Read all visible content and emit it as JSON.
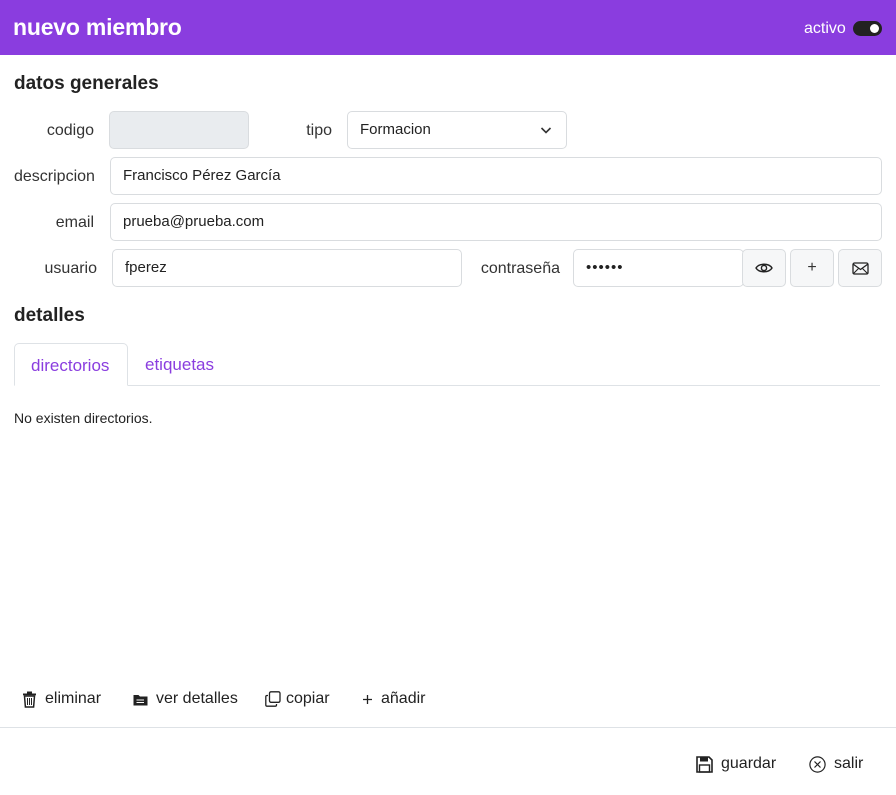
{
  "header": {
    "title": "nuevo miembro",
    "active_label": "activo",
    "active_on": true,
    "color": "#8a3ddf"
  },
  "general": {
    "title": "datos generales",
    "codigo": {
      "label": "codigo",
      "value": ""
    },
    "tipo": {
      "label": "tipo",
      "value": "Formacion"
    },
    "descripcion": {
      "label": "descripcion",
      "value": "Francisco Pérez García"
    },
    "email": {
      "label": "email",
      "value": "prueba@prueba.com"
    },
    "usuario": {
      "label": "usuario",
      "value": "fperez"
    },
    "contrasena": {
      "label": "contraseña",
      "value": "••••••"
    },
    "buttons": {
      "show_icon": "eye-icon",
      "generate_label": "+",
      "send_icon": "envelope-icon"
    }
  },
  "details": {
    "title": "detalles",
    "tabs": [
      {
        "label": "directorios",
        "active": true
      },
      {
        "label": "etiquetas",
        "active": false
      }
    ],
    "empty_message": "No existen directorios."
  },
  "actions": {
    "delete_label": "eliminar",
    "details_label": "ver detalles",
    "copy_label": "copiar",
    "add_label": "añadir"
  },
  "footer": {
    "save_label": "guardar",
    "exit_label": "salir"
  }
}
